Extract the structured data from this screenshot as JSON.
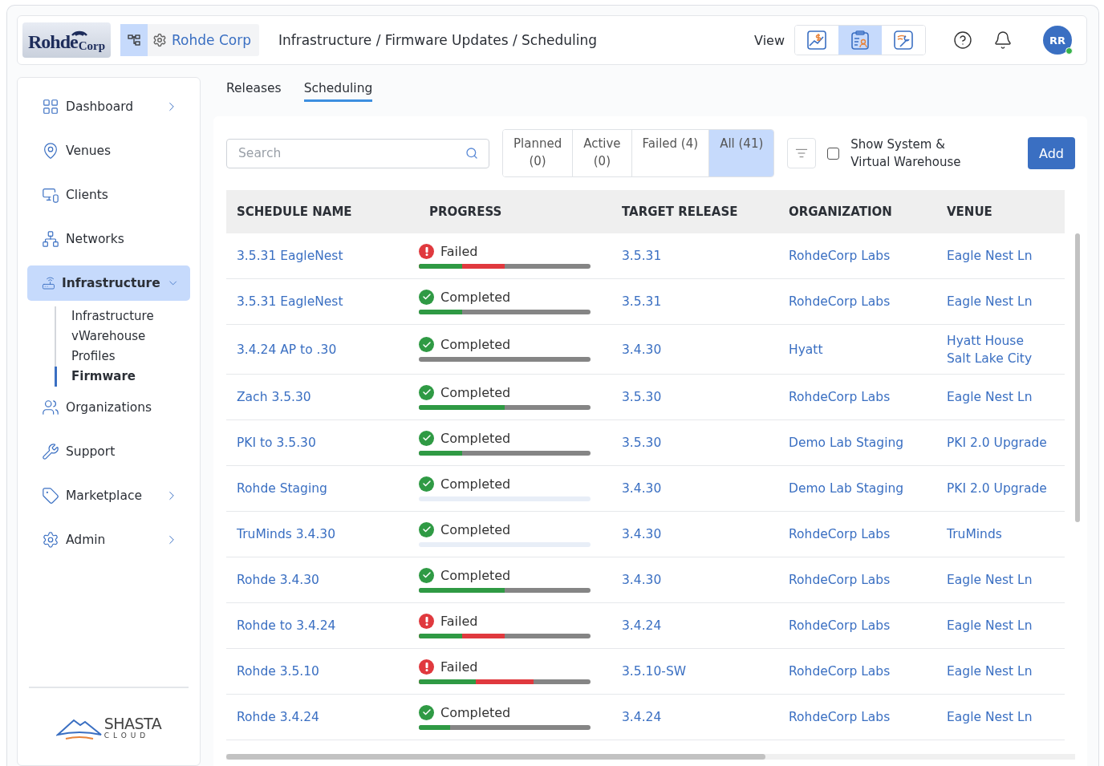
{
  "header": {
    "logo": {
      "main": "Rohde",
      "suffix": "Corp"
    },
    "org_switcher": {
      "label": "Rohde Corp"
    },
    "breadcrumb": "Infrastructure / Firmware Updates / Scheduling",
    "view_label": "View",
    "views": [
      {
        "kind": "finance",
        "selected": false
      },
      {
        "kind": "checklist",
        "selected": true
      },
      {
        "kind": "tools",
        "selected": false
      }
    ],
    "avatar": {
      "initials": "RR",
      "online": true
    }
  },
  "sidebar": {
    "items": [
      {
        "label": "Dashboard",
        "expandable": true,
        "expanded": false,
        "selected": false
      },
      {
        "label": "Venues",
        "expandable": false,
        "selected": false
      },
      {
        "label": "Clients",
        "expandable": false,
        "selected": false
      },
      {
        "label": "Networks",
        "expandable": false,
        "selected": false
      },
      {
        "label": "Infrastructure",
        "expandable": true,
        "expanded": true,
        "selected": true,
        "children": [
          {
            "label": "Infrastructure",
            "selected": false
          },
          {
            "label": "vWarehouse",
            "selected": false
          },
          {
            "label": "Profiles",
            "selected": false
          },
          {
            "label": "Firmware",
            "selected": true
          }
        ]
      },
      {
        "label": "Organizations",
        "expandable": false,
        "selected": false
      },
      {
        "label": "Support",
        "expandable": false,
        "selected": false
      },
      {
        "label": "Marketplace",
        "expandable": true,
        "expanded": false,
        "selected": false
      },
      {
        "label": "Admin",
        "expandable": true,
        "expanded": false,
        "selected": false
      }
    ],
    "footer_logo": {
      "name": "SHASTA",
      "tagline": "CLOUD"
    }
  },
  "tabs": [
    {
      "label": "Releases",
      "selected": false
    },
    {
      "label": "Scheduling",
      "selected": true
    }
  ],
  "toolbar": {
    "search": {
      "placeholder": "Search"
    },
    "filters": [
      {
        "label": "Planned\n(0)",
        "selected": false
      },
      {
        "label": "Active\n(0)",
        "selected": false
      },
      {
        "label": "Failed (4)",
        "selected": false
      },
      {
        "label": "All (41)",
        "selected": true
      }
    ],
    "show_system": {
      "label": "Show System &\nVirtual Warehouse",
      "checked": false
    },
    "add_button": "Add"
  },
  "table": {
    "columns": [
      "SCHEDULE NAME",
      "PROGRESS",
      "TARGET RELEASE",
      "ORGANIZATION",
      "VENUE"
    ],
    "rows": [
      {
        "name": "3.5.31 EagleNest",
        "progress": {
          "kind": "failed",
          "label": "Failed",
          "loaded": true,
          "segments": [
            {
              "kind": "failed",
              "level": 0.5
            },
            {
              "kind": "success",
              "level": 0.25
            }
          ]
        },
        "release": "3.5.31",
        "organization": "RohdeCorp Labs",
        "venue": "Eagle Nest Ln"
      },
      {
        "name": "3.5.31 EagleNest",
        "progress": {
          "kind": "completed",
          "label": "Completed",
          "loaded": true,
          "segments": [
            {
              "kind": "success",
              "level": 0.25
            }
          ]
        },
        "release": "3.5.31",
        "organization": "RohdeCorp Labs",
        "venue": "Eagle Nest Ln"
      },
      {
        "name": "3.4.24 AP to .30",
        "progress": {
          "kind": "completed",
          "label": "Completed",
          "loaded": true
        },
        "release": "3.4.30",
        "organization": "Hyatt",
        "venue": "Hyatt House Salt Lake City"
      },
      {
        "name": "Zach 3.5.30",
        "progress": {
          "kind": "completed",
          "label": "Completed",
          "loaded": true,
          "segments": [
            {
              "kind": "success",
              "level": 0.5
            }
          ]
        },
        "release": "3.5.30",
        "organization": "RohdeCorp Labs",
        "venue": "Eagle Nest Ln"
      },
      {
        "name": "PKI to 3.5.30",
        "progress": {
          "kind": "completed",
          "label": "Completed",
          "loaded": true,
          "segments": [
            {
              "kind": "success",
              "level": 0.25
            }
          ]
        },
        "release": "3.5.30",
        "organization": "Demo Lab Staging",
        "venue": "PKI 2.0 Upgrade"
      },
      {
        "name": "Rohde Staging",
        "progress": {
          "kind": "completed",
          "label": "Completed",
          "loaded": false
        },
        "release": "3.4.30",
        "organization": "Demo Lab Staging",
        "venue": "PKI 2.0 Upgrade"
      },
      {
        "name": "TruMinds 3.4.30",
        "progress": {
          "kind": "completed",
          "label": "Completed",
          "loaded": false
        },
        "release": "3.4.30",
        "organization": "RohdeCorp Labs",
        "venue": "TruMinds"
      },
      {
        "name": "Rohde 3.4.30",
        "progress": {
          "kind": "completed",
          "label": "Completed",
          "loaded": true,
          "segments": [
            {
              "kind": "success",
              "level": 0.5
            }
          ]
        },
        "release": "3.4.30",
        "organization": "RohdeCorp Labs",
        "venue": "Eagle Nest Ln"
      },
      {
        "name": "Rohde to 3.4.24",
        "progress": {
          "kind": "failed",
          "label": "Failed",
          "loaded": true,
          "segments": [
            {
              "kind": "failed",
              "level": 0.5
            },
            {
              "kind": "success",
              "level": 0.25
            }
          ]
        },
        "release": "3.4.24",
        "organization": "RohdeCorp Labs",
        "venue": "Eagle Nest Ln"
      },
      {
        "name": "Rohde 3.5.10",
        "progress": {
          "kind": "failed",
          "label": "Failed",
          "loaded": true,
          "segments": [
            {
              "kind": "failed",
              "level": 0.67
            },
            {
              "kind": "success",
              "level": 0.33
            }
          ]
        },
        "release": "3.5.10-SW",
        "organization": "RohdeCorp Labs",
        "venue": "Eagle Nest Ln"
      },
      {
        "name": "Rohde 3.4.24",
        "progress": {
          "kind": "completed",
          "label": "Completed",
          "loaded": true,
          "segments": [
            {
              "kind": "success",
              "level": 0.18
            }
          ]
        },
        "release": "3.4.24",
        "organization": "RohdeCorp Labs",
        "venue": "Eagle Nest Ln"
      }
    ]
  }
}
